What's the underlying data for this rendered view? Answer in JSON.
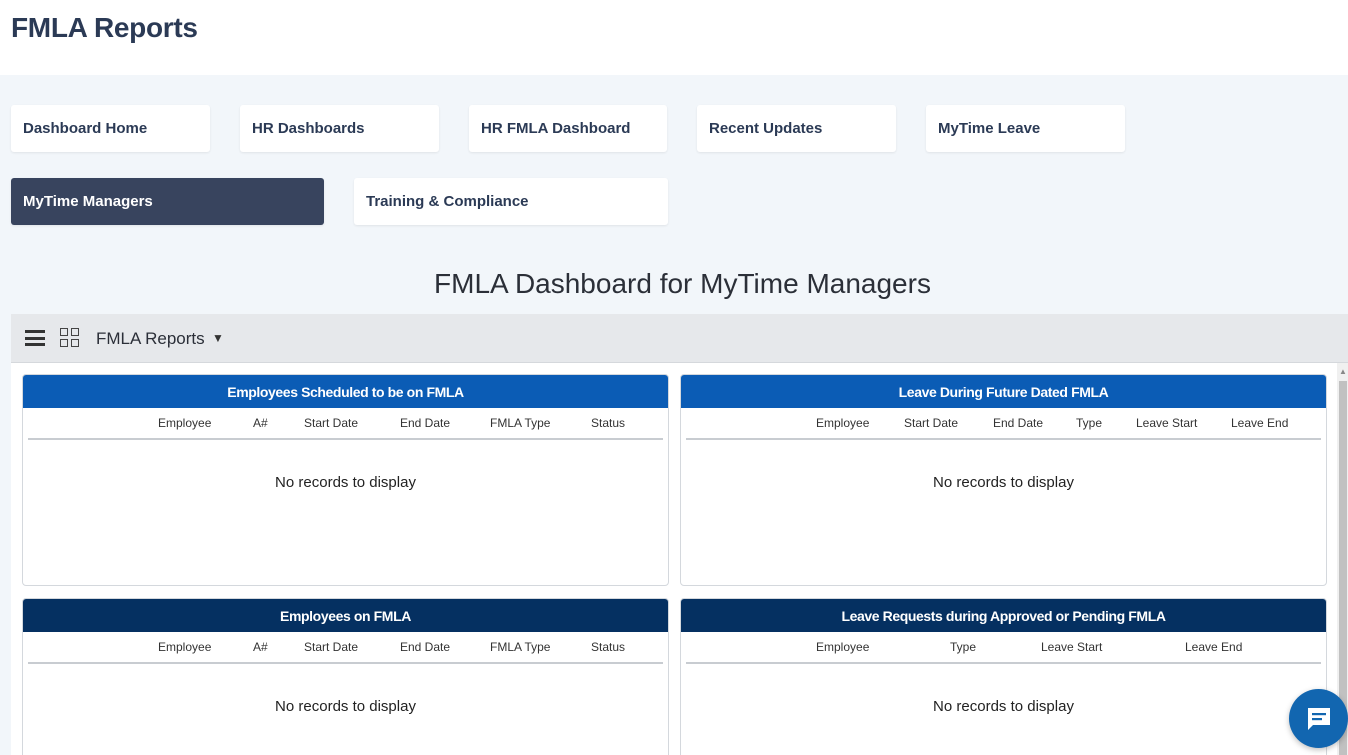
{
  "header": {
    "title": "FMLA Reports"
  },
  "nav": {
    "items": [
      {
        "label": "Dashboard Home",
        "active": false
      },
      {
        "label": "HR Dashboards",
        "active": false
      },
      {
        "label": "HR FMLA Dashboard",
        "active": false
      },
      {
        "label": "Recent Updates",
        "active": false
      },
      {
        "label": "MyTime Leave",
        "active": false
      },
      {
        "label": "MyTime Managers",
        "active": true
      },
      {
        "label": "Training & Compliance",
        "active": false
      }
    ]
  },
  "dashboard": {
    "title": "FMLA Dashboard for MyTime Managers"
  },
  "toolbar": {
    "menu_icon": "hamburger-menu-icon",
    "grid_icon": "grid-layout-icon",
    "selector_label": "FMLA Reports",
    "caret": "▼"
  },
  "panels": [
    {
      "title": "Employees Scheduled to be on FMLA",
      "header_color": "#0b5cb5",
      "columns": [
        "Employee",
        "A#",
        "Start Date",
        "End Date",
        "FMLA Type",
        "Status"
      ],
      "empty_text": "No records to display"
    },
    {
      "title": "Leave During Future Dated FMLA",
      "header_color": "#0b5cb5",
      "columns": [
        "Employee",
        "Start Date",
        "End Date",
        "Type",
        "Leave Start",
        "Leave End"
      ],
      "empty_text": "No records to display"
    },
    {
      "title": "Employees on FMLA",
      "header_color": "#053061",
      "columns": [
        "Employee",
        "A#",
        "Start Date",
        "End Date",
        "FMLA Type",
        "Status"
      ],
      "empty_text": "No records to display"
    },
    {
      "title": "Leave Requests during Approved or Pending FMLA",
      "header_color": "#053061",
      "columns": [
        "Employee",
        "Type",
        "Leave Start",
        "Leave End"
      ],
      "empty_text": "No records to display"
    }
  ],
  "chat": {
    "icon": "chat-bubble-icon"
  },
  "colors": {
    "active_nav": "#38445e",
    "accent_blue": "#0b5cb5",
    "accent_navy": "#053061",
    "chat_button": "#1266b0"
  }
}
